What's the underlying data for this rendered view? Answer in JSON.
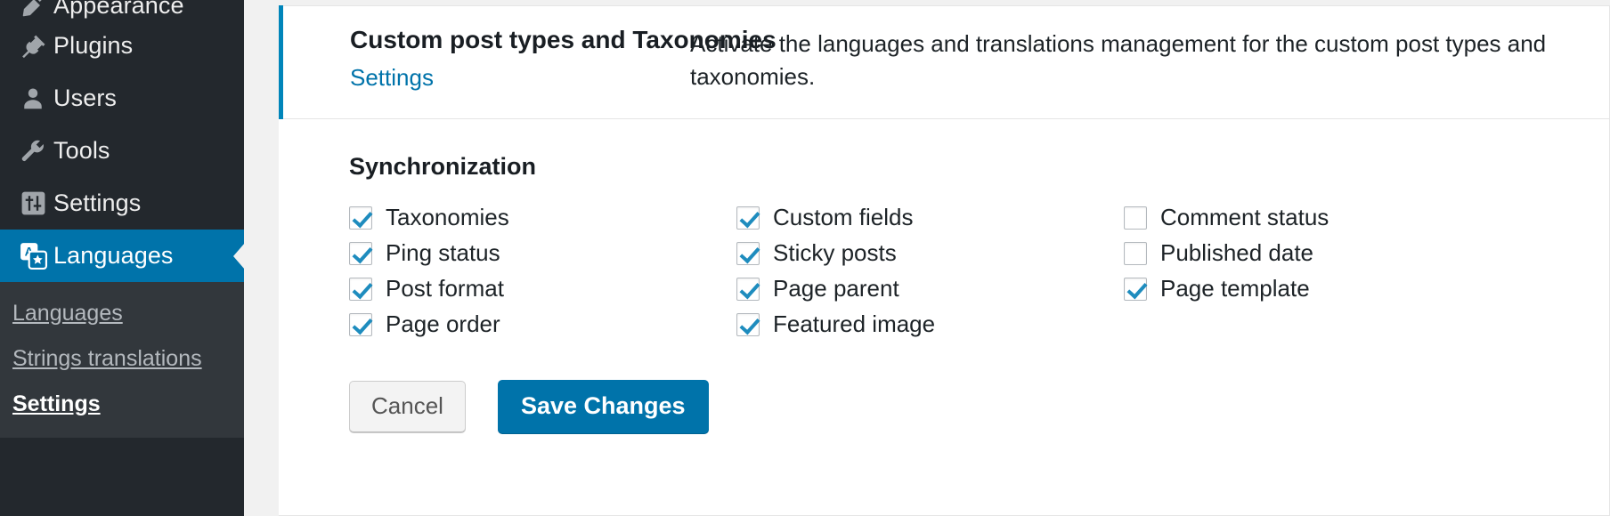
{
  "sidebar": {
    "items": [
      {
        "label": "Appearance",
        "icon": "appearance-icon",
        "current": false,
        "partial": true
      },
      {
        "label": "Plugins",
        "icon": "plugins-icon",
        "current": false,
        "partial": false
      },
      {
        "label": "Users",
        "icon": "users-icon",
        "current": false,
        "partial": false
      },
      {
        "label": "Tools",
        "icon": "tools-icon",
        "current": false,
        "partial": false
      },
      {
        "label": "Settings",
        "icon": "settings-icon",
        "current": false,
        "partial": false
      },
      {
        "label": "Languages",
        "icon": "languages-icon",
        "current": true,
        "partial": false
      }
    ],
    "submenu": [
      {
        "label": "Languages",
        "active": false
      },
      {
        "label": "Strings translations",
        "active": false
      },
      {
        "label": "Settings",
        "active": true
      }
    ]
  },
  "panel": {
    "title": "Custom post types and Taxonomies",
    "settings_link": "Settings",
    "description": "Activate the languages and translations management for the custom post types and\ntaxonomies.",
    "accent_color": "#0085ba"
  },
  "sync": {
    "heading": "Synchronization",
    "columns": [
      [
        {
          "label": "Taxonomies",
          "checked": true
        },
        {
          "label": "Ping status",
          "checked": true
        },
        {
          "label": "Post format",
          "checked": true
        },
        {
          "label": "Page order",
          "checked": true
        }
      ],
      [
        {
          "label": "Custom fields",
          "checked": true
        },
        {
          "label": "Sticky posts",
          "checked": true
        },
        {
          "label": "Page parent",
          "checked": true
        },
        {
          "label": "Featured image",
          "checked": true
        }
      ],
      [
        {
          "label": "Comment status",
          "checked": false
        },
        {
          "label": "Published date",
          "checked": false
        },
        {
          "label": "Page template",
          "checked": true
        }
      ]
    ]
  },
  "actions": {
    "cancel_label": "Cancel",
    "save_label": "Save Changes",
    "save_color": "#0073aa"
  }
}
